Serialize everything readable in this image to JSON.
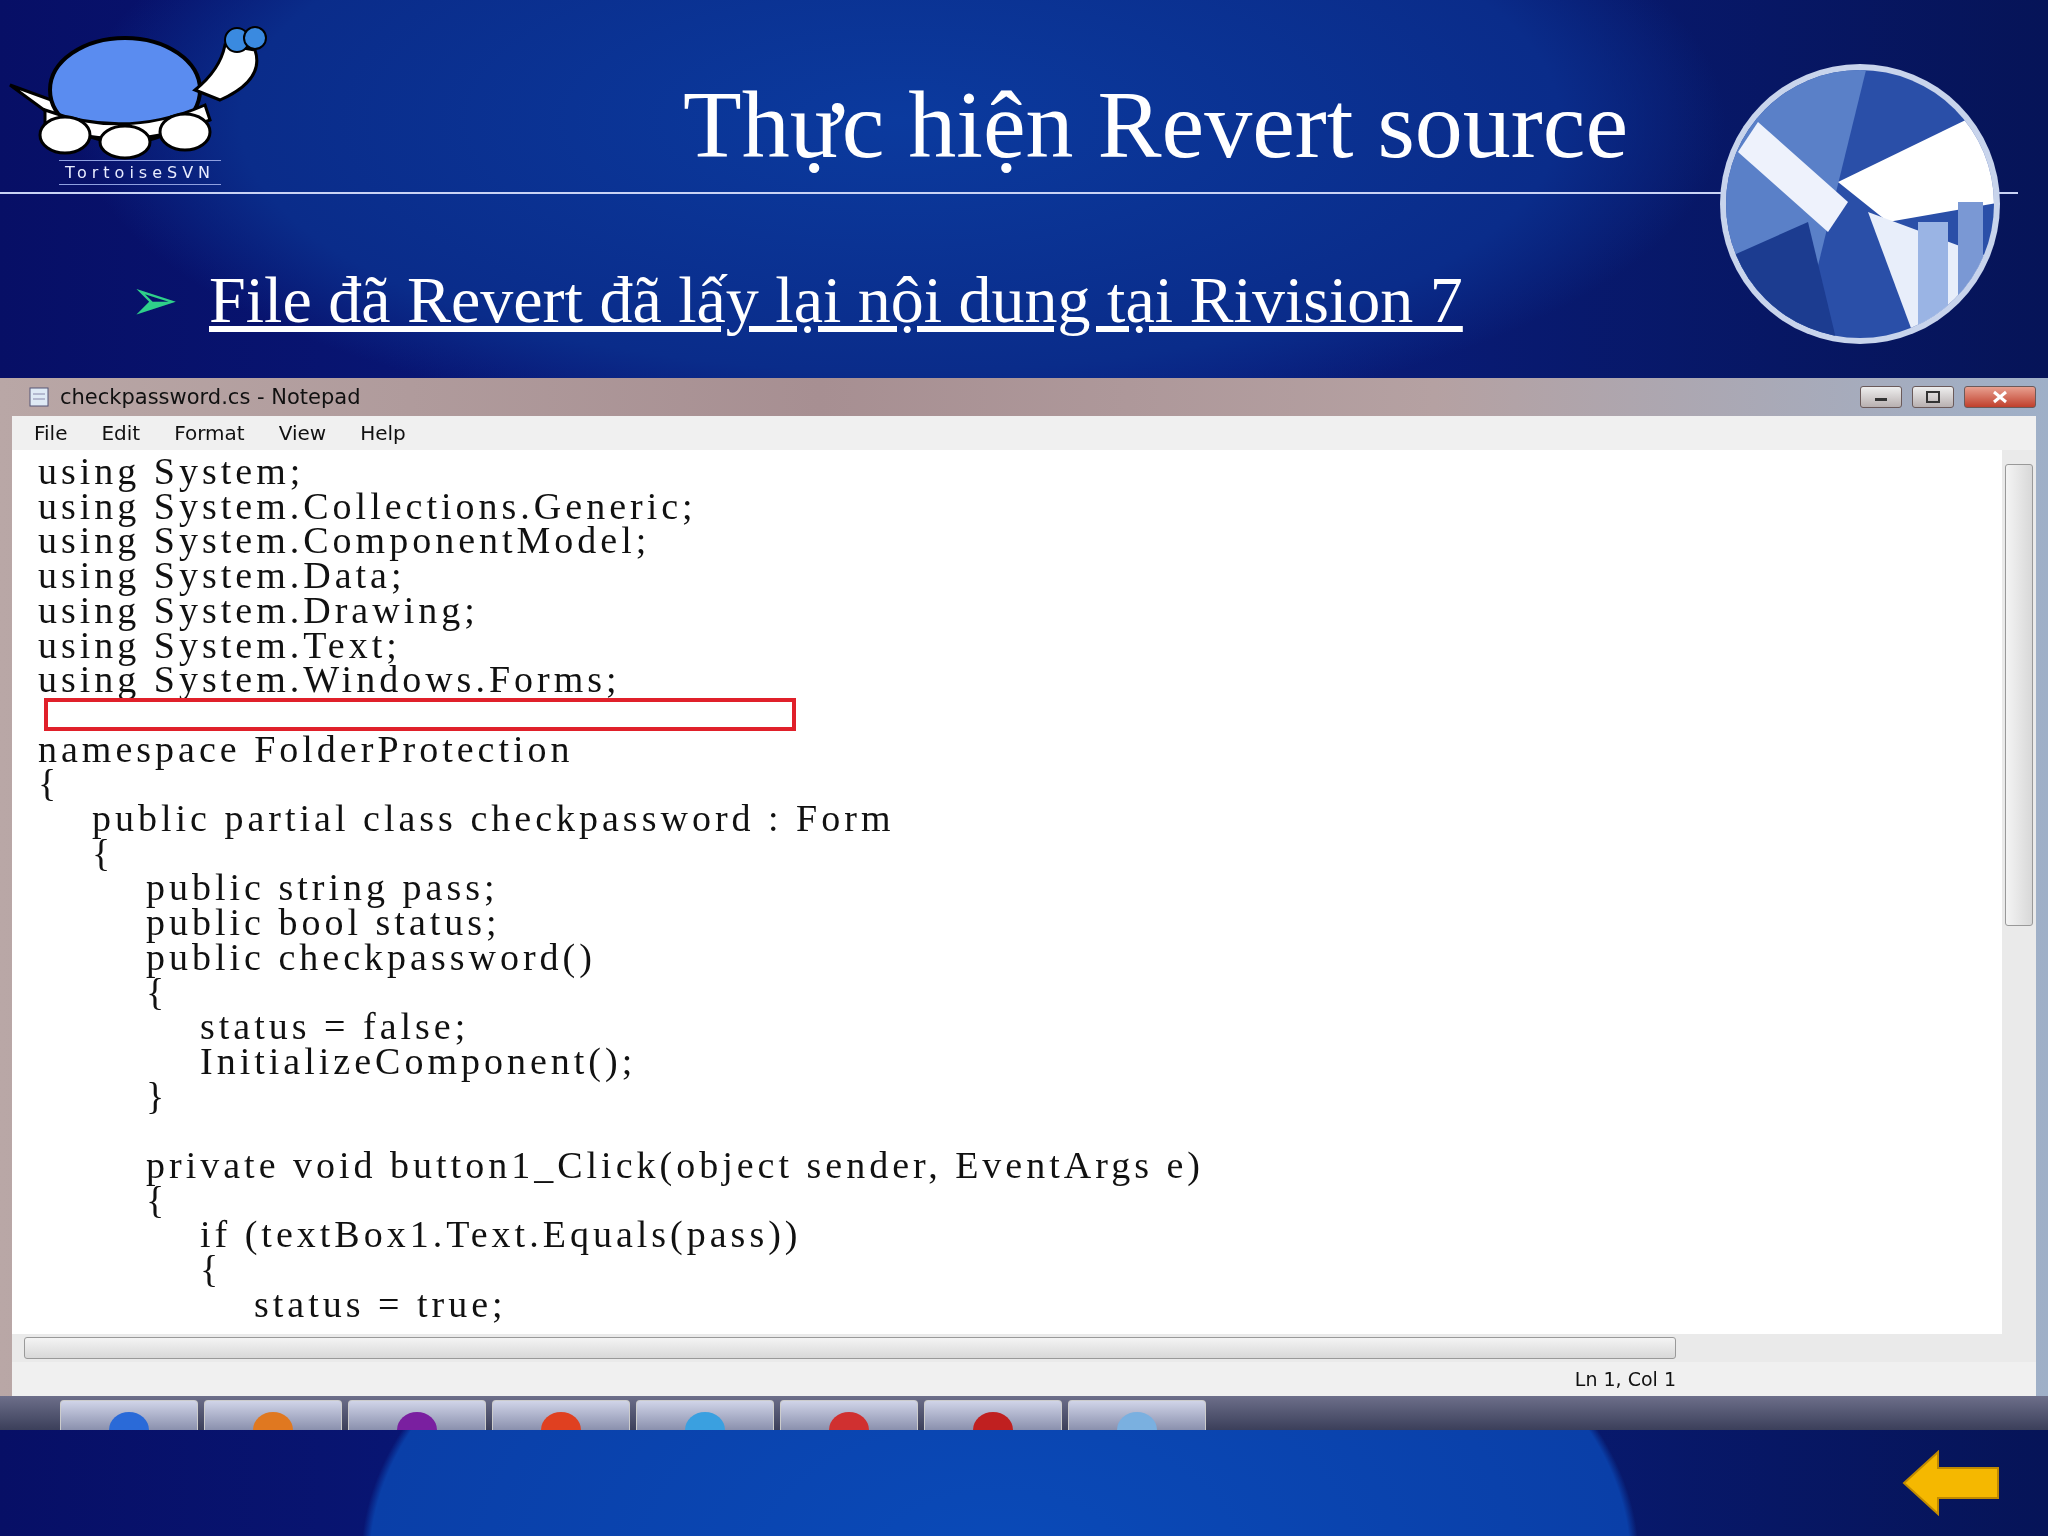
{
  "slide": {
    "logo_caption": "TortoiseSVN",
    "title": "Thực hiện Revert source",
    "bullet": {
      "marker": "➢",
      "text": "File đã Revert đã lấy lại nội dung tại Rivision 7"
    }
  },
  "window": {
    "title": "checkpassword.cs - Notepad",
    "menu": [
      "File",
      "Edit",
      "Format",
      "View",
      "Help"
    ],
    "lines": [
      {
        "text": "using System;",
        "gap_before": false
      },
      {
        "text": "using System.Collections.Generic;",
        "gap_before": false
      },
      {
        "text": "using System.ComponentModel;",
        "gap_before": false
      },
      {
        "text": "using System.Data;",
        "gap_before": false
      },
      {
        "text": "using System.Drawing;",
        "gap_before": false
      },
      {
        "text": "using System.Text;",
        "gap_before": false
      },
      {
        "text": "using System.Windows.Forms;",
        "gap_before": false
      },
      {
        "text": "namespace FolderProtection",
        "gap_before": true
      },
      {
        "text": "{",
        "gap_before": false
      },
      {
        "text": "    public partial class checkpassword : Form",
        "gap_before": false
      },
      {
        "text": "    {",
        "gap_before": false
      },
      {
        "text": "        public string pass;",
        "gap_before": false
      },
      {
        "text": "        public bool status;",
        "gap_before": false
      },
      {
        "text": "        public checkpassword()",
        "gap_before": false
      },
      {
        "text": "        {",
        "gap_before": false
      },
      {
        "text": "            status = false;",
        "gap_before": false
      },
      {
        "text": "            InitializeComponent();",
        "gap_before": false
      },
      {
        "text": "        }",
        "gap_before": false
      },
      {
        "text": "        private void button1_Click(object sender, EventArgs e)",
        "gap_before": true
      },
      {
        "text": "        {",
        "gap_before": false
      },
      {
        "text": "            if (textBox1.Text.Equals(pass))",
        "gap_before": false
      },
      {
        "text": "            {",
        "gap_before": false
      },
      {
        "text": "                status = true;",
        "gap_before": false
      }
    ],
    "status_bar": "Ln 1, Col 1"
  }
}
